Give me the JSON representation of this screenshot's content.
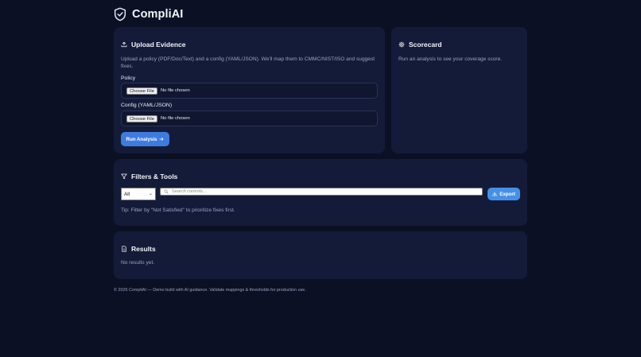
{
  "app": {
    "name": "CompliAI",
    "logo_icon": "shield-check-icon"
  },
  "upload": {
    "title": "Upload Evidence",
    "icon": "upload-icon",
    "description": "Upload a policy (PDF/Doc/Text) and a config (YAML/JSON). We'll map them to CMMC/NIST/ISO and suggest fixes.",
    "policy_label": "Policy",
    "config_label": "Config (YAML/JSON)",
    "choose_file_label": "Choose File",
    "no_file_text": "No file chosen",
    "run_label": "Run Analysis",
    "run_icon": "arrow-right-icon"
  },
  "scorecard": {
    "title": "Scorecard",
    "icon": "gear-icon",
    "text": "Run an analysis to see your coverage score."
  },
  "filters": {
    "title": "Filters & Tools",
    "icon": "filter-icon",
    "select_value": "All",
    "search_placeholder": "Search controls...",
    "export_label": "Export",
    "export_icon": "download-icon",
    "tip": "Tip: Filter by \"Not Satisfied\" to prioritize fixes first."
  },
  "results": {
    "title": "Results",
    "icon": "document-icon",
    "empty_text": "No results yet."
  },
  "footer": {
    "text": "© 2025 CompliAI — Demo build with AI guidance. Validate mappings & thresholds for production use."
  },
  "colors": {
    "background": "#0b1024",
    "card": "#141b38",
    "accent_run": "#3d7be0",
    "accent_export": "#4590e6",
    "muted_text": "#98a3bf"
  }
}
